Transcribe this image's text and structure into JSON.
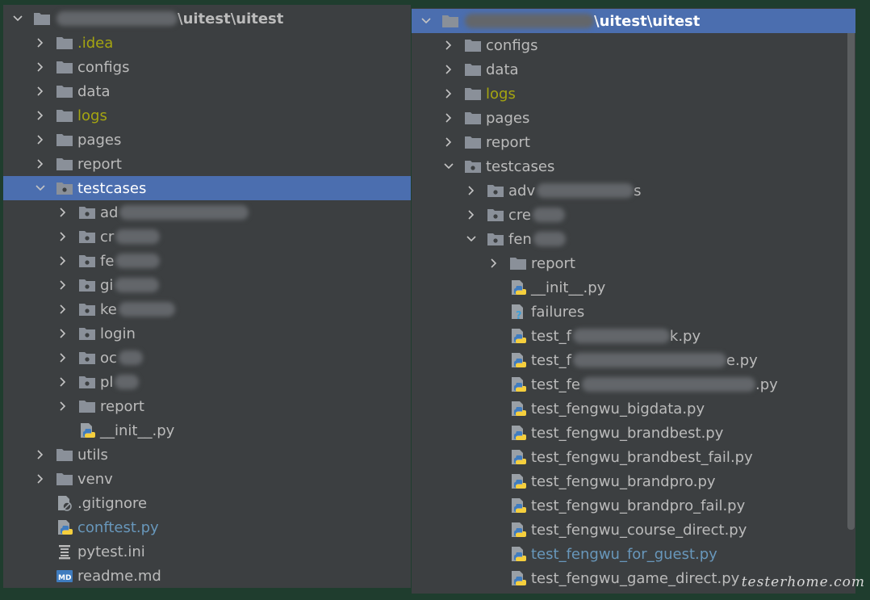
{
  "left": {
    "root_label": "\\uitest\\uitest",
    "rows": [
      {
        "depth": 0,
        "arrow": "down",
        "icon": "folder",
        "label": "\\uitest\\uitest",
        "blur": 150,
        "bold": true
      },
      {
        "depth": 1,
        "arrow": "right",
        "icon": "folder",
        "label": ".idea",
        "color": "yellow"
      },
      {
        "depth": 1,
        "arrow": "right",
        "icon": "folder",
        "label": "configs"
      },
      {
        "depth": 1,
        "arrow": "right",
        "icon": "folder",
        "label": "data"
      },
      {
        "depth": 1,
        "arrow": "right",
        "icon": "folder",
        "label": "logs",
        "color": "yellow"
      },
      {
        "depth": 1,
        "arrow": "right",
        "icon": "folder",
        "label": "pages"
      },
      {
        "depth": 1,
        "arrow": "right",
        "icon": "folder",
        "label": "report"
      },
      {
        "depth": 1,
        "arrow": "down",
        "icon": "package",
        "label": "testcases",
        "selected": true
      },
      {
        "depth": 2,
        "arrow": "right",
        "icon": "package",
        "label": "ad",
        "blur": 160
      },
      {
        "depth": 2,
        "arrow": "right",
        "icon": "package",
        "label": "cr",
        "blur": 55
      },
      {
        "depth": 2,
        "arrow": "right",
        "icon": "package",
        "label": "fe",
        "blur": 55
      },
      {
        "depth": 2,
        "arrow": "right",
        "icon": "package",
        "label": "gi",
        "blur": 55
      },
      {
        "depth": 2,
        "arrow": "right",
        "icon": "package",
        "label": "ke",
        "blur": 70
      },
      {
        "depth": 2,
        "arrow": "right",
        "icon": "package",
        "label": "login"
      },
      {
        "depth": 2,
        "arrow": "right",
        "icon": "package",
        "label": "oc",
        "blur": 30
      },
      {
        "depth": 2,
        "arrow": "right",
        "icon": "package",
        "label": "pl",
        "blur": 30
      },
      {
        "depth": 2,
        "arrow": "right",
        "icon": "folder",
        "label": "report"
      },
      {
        "depth": 2,
        "arrow": "none",
        "icon": "python",
        "label": "__init__.py"
      },
      {
        "depth": 1,
        "arrow": "right",
        "icon": "folder",
        "label": "utils"
      },
      {
        "depth": 1,
        "arrow": "right",
        "icon": "folder",
        "label": "venv"
      },
      {
        "depth": 1,
        "arrow": "none",
        "icon": "gitignore",
        "label": ".gitignore"
      },
      {
        "depth": 1,
        "arrow": "none",
        "icon": "python",
        "label": "conftest.py",
        "color": "blue"
      },
      {
        "depth": 1,
        "arrow": "none",
        "icon": "ini",
        "label": "pytest.ini"
      },
      {
        "depth": 1,
        "arrow": "none",
        "icon": "md",
        "label": "readme.md"
      }
    ]
  },
  "right": {
    "rows": [
      {
        "depth": 0,
        "arrow": "down",
        "icon": "folder",
        "label": "\\uitest\\uitest",
        "blur": 160,
        "bold": true,
        "selected": true
      },
      {
        "depth": 1,
        "arrow": "right",
        "icon": "folder",
        "label": "configs"
      },
      {
        "depth": 1,
        "arrow": "right",
        "icon": "folder",
        "label": "data"
      },
      {
        "depth": 1,
        "arrow": "right",
        "icon": "folder",
        "label": "logs",
        "color": "yellow"
      },
      {
        "depth": 1,
        "arrow": "right",
        "icon": "folder",
        "label": "pages"
      },
      {
        "depth": 1,
        "arrow": "right",
        "icon": "folder",
        "label": "report"
      },
      {
        "depth": 1,
        "arrow": "down",
        "icon": "package",
        "label": "testcases"
      },
      {
        "depth": 2,
        "arrow": "right",
        "icon": "package",
        "label": "adv",
        "blur": 120,
        "suffix": "s"
      },
      {
        "depth": 2,
        "arrow": "right",
        "icon": "package",
        "label": "cre",
        "blur": 40
      },
      {
        "depth": 2,
        "arrow": "down",
        "icon": "package",
        "label": "fen",
        "blur": 40
      },
      {
        "depth": 3,
        "arrow": "right",
        "icon": "folder",
        "label": "report"
      },
      {
        "depth": 3,
        "arrow": "none",
        "icon": "python",
        "label": "__init__.py"
      },
      {
        "depth": 3,
        "arrow": "none",
        "icon": "failures",
        "label": "failures"
      },
      {
        "depth": 3,
        "arrow": "none",
        "icon": "python",
        "label": "test_f",
        "blur": 120,
        "suffix": "k.py"
      },
      {
        "depth": 3,
        "arrow": "none",
        "icon": "python",
        "label": "test_f",
        "blur": 190,
        "suffix": "e.py"
      },
      {
        "depth": 3,
        "arrow": "none",
        "icon": "python",
        "label": "test_fe",
        "blur": 215,
        "suffix": ".py"
      },
      {
        "depth": 3,
        "arrow": "none",
        "icon": "python",
        "label": "test_fengwu_bigdata.py",
        "faded": true
      },
      {
        "depth": 3,
        "arrow": "none",
        "icon": "python",
        "label": "test_fengwu_brandbest.py",
        "faded": true
      },
      {
        "depth": 3,
        "arrow": "none",
        "icon": "python",
        "label": "test_fengwu_brandbest_fail.py",
        "faded": true
      },
      {
        "depth": 3,
        "arrow": "none",
        "icon": "python",
        "label": "test_fengwu_brandpro.py",
        "faded": true
      },
      {
        "depth": 3,
        "arrow": "none",
        "icon": "python",
        "label": "test_fengwu_brandpro_fail.py",
        "faded": true
      },
      {
        "depth": 3,
        "arrow": "none",
        "icon": "python",
        "label": "test_fengwu_course_direct.py",
        "faded": true
      },
      {
        "depth": 3,
        "arrow": "none",
        "icon": "python",
        "label": "test_fengwu_for_guest.py",
        "color": "blue",
        "faded": true
      },
      {
        "depth": 3,
        "arrow": "none",
        "icon": "python",
        "label": "test_fengwu_game_direct.py",
        "faded": true
      }
    ]
  },
  "watermark": "testerhome.com",
  "colors": {
    "folder": "#8a9099",
    "selection": "#4b6eaf",
    "text": "#bbbbbb",
    "yellow_text": "#a5a511",
    "blue_text": "#6897bb"
  }
}
